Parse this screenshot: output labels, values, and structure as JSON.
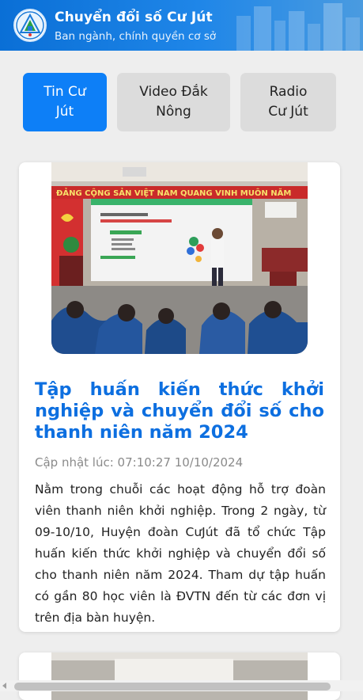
{
  "header": {
    "title": "Chuyển đổi số Cư Jút",
    "subtitle": "Ban ngành, chính quyền cơ sở",
    "logo_icon": "district-emblem-icon"
  },
  "tabs": [
    {
      "label": "Tin Cư Jút",
      "active": true
    },
    {
      "label": "Video Đắk Nông",
      "active": false
    },
    {
      "label": "Radio Cư Jút",
      "active": false
    }
  ],
  "articles": [
    {
      "title": "Tập huấn kiến thức khởi nghiệp và chuyển đổi số cho thanh niên năm 2024",
      "date": "Cập nhật lúc: 07:10:27 10/10/2024",
      "summary": "Nằm trong chuỗi các hoạt động hỗ trợ đoàn viên thanh niên khởi nghiệp. Trong 2 ngày, từ 09-10/10, Huyện đoàn CưJút đã tổ chức Tập huấn kiến thức khởi nghiệp và chuyển đổi số cho thanh niên năm 2024. Tham dự tập huấn có gần 80 học viên là ĐVTN đến từ các đơn vị trên địa bàn huyện.",
      "banner_text": "ĐẢNG CỘNG SẢN VIỆT NAM QUANG VINH MUÔN NĂM"
    }
  ],
  "colors": {
    "header": "#0a6fd6",
    "accent": "#0d7ff7",
    "title": "#0d6fe0"
  }
}
